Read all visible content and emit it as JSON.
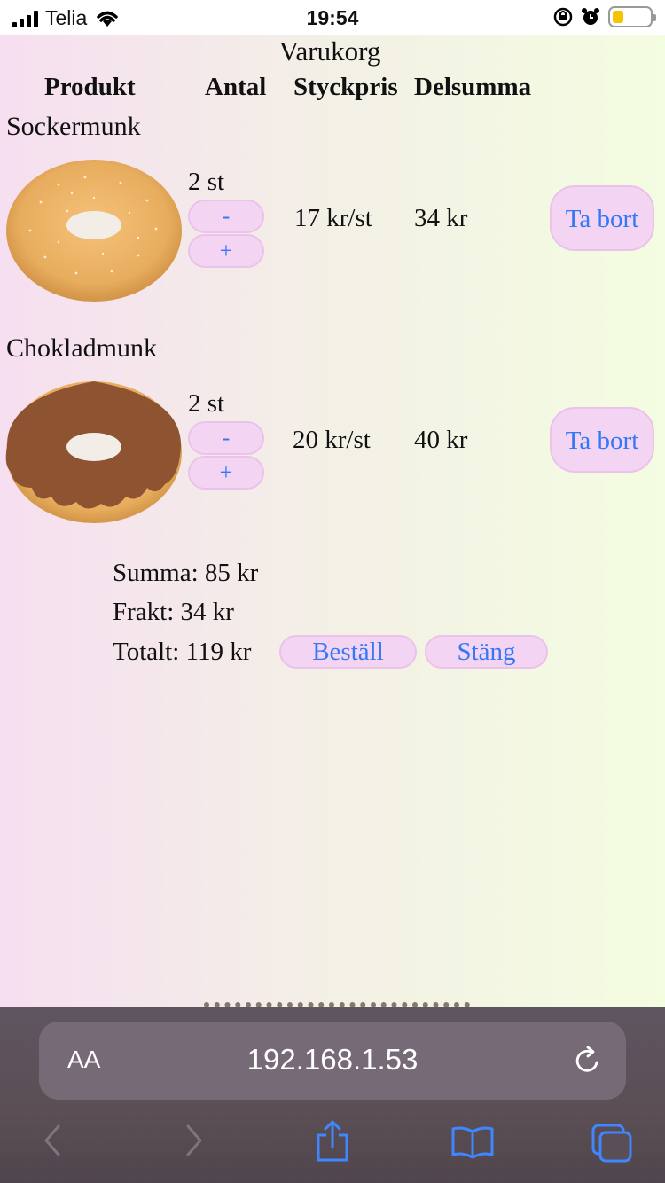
{
  "status_bar": {
    "carrier": "Telia",
    "time": "19:54"
  },
  "cart": {
    "title": "Varukorg",
    "headers": {
      "product": "Produkt",
      "quantity": "Antal",
      "unit_price": "Styckpris",
      "subtotal": "Delsumma"
    },
    "items": [
      {
        "name": "Sockermunk",
        "quantity": "2 st",
        "minus": "-",
        "plus": "+",
        "unit_price": "17 kr/st",
        "subtotal": "34 kr",
        "remove_label": "Ta bort",
        "image": "sugar-donut"
      },
      {
        "name": "Chokladmunk",
        "quantity": "2 st",
        "minus": "-",
        "plus": "+",
        "unit_price": "20 kr/st",
        "subtotal": "40 kr",
        "remove_label": "Ta bort",
        "image": "chocolate-donut"
      }
    ],
    "sum": "Summa: 85 kr",
    "shipping": "Frakt: 34 kr",
    "total": "Totalt: 119 kr",
    "order_label": "Beställ",
    "close_label": "Stäng"
  },
  "browser": {
    "aa_label": "AA",
    "url": "192.168.1.53"
  },
  "colors": {
    "button_bg": "#f3d4f3",
    "button_border": "#ebc2ea",
    "link": "#3478f6",
    "battery": "#f5c400"
  }
}
